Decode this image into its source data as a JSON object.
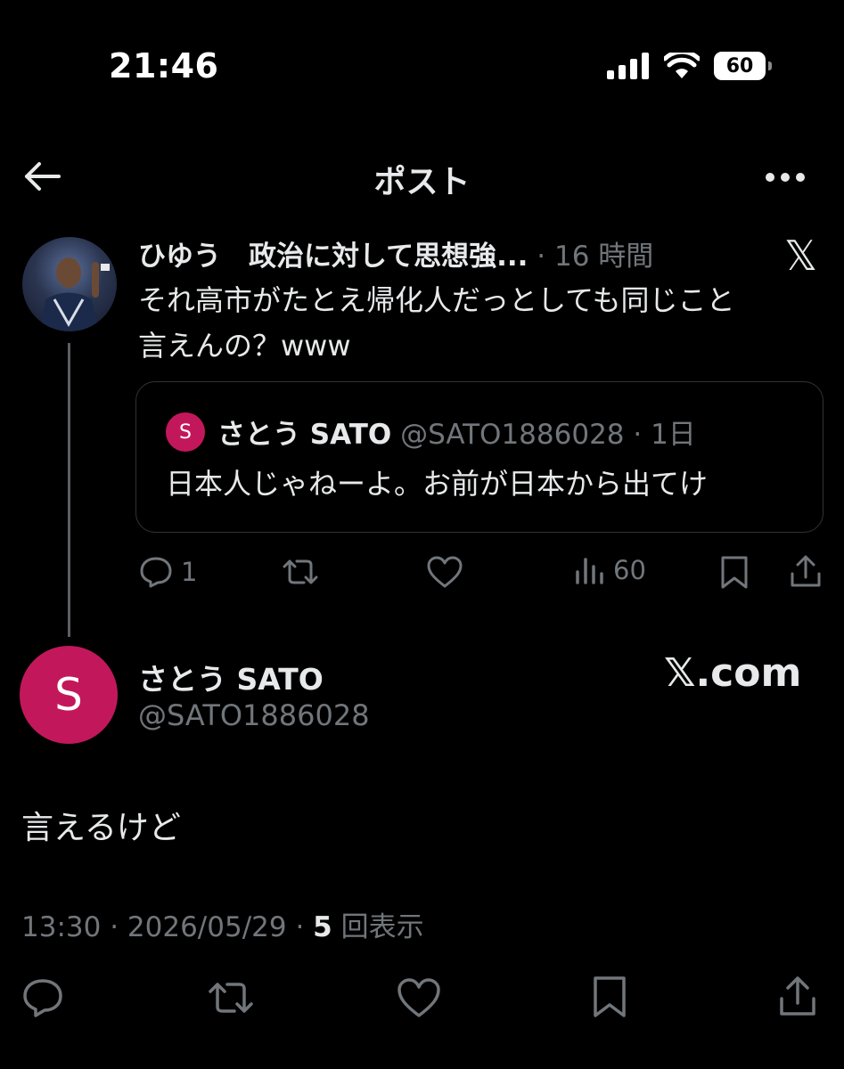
{
  "status_bar": {
    "time": "21:46",
    "battery": "60"
  },
  "header": {
    "title": "ポスト"
  },
  "reply_post": {
    "display_name": "ひゆう　政治に対して思想強...",
    "time_ago": "16 時間",
    "text_line1": "それ高市がたとえ帰化人だっとしても同じこと",
    "text_line2": "言えんの？www",
    "quote": {
      "avatar_letter": "S",
      "display_name": "さとう SATO",
      "handle": "@SATO1886028",
      "time_ago": "1日",
      "text": "日本人じゃねーよ。お前が日本から出てけ"
    },
    "actions": {
      "reply_count": "1",
      "views_count": "60"
    }
  },
  "main_post": {
    "avatar_letter": "S",
    "display_name": "さとう SATO",
    "handle": "@SATO1886028",
    "watermark": "𝕏.com",
    "text": "言えるけど",
    "time": "13:30",
    "date": "2026/05/29",
    "view_count": "5",
    "view_label": "回表示"
  },
  "colors": {
    "background": "#000000",
    "text": "#e7e9ea",
    "muted": "#71767b",
    "avatar_pink": "#c2185b",
    "border": "#2f3336"
  },
  "icons": [
    "back-arrow-icon",
    "more-icon",
    "x-logo-icon",
    "reply-icon",
    "repost-icon",
    "like-icon",
    "views-icon",
    "bookmark-icon",
    "share-icon",
    "signal-icon",
    "wifi-icon",
    "battery-icon"
  ]
}
